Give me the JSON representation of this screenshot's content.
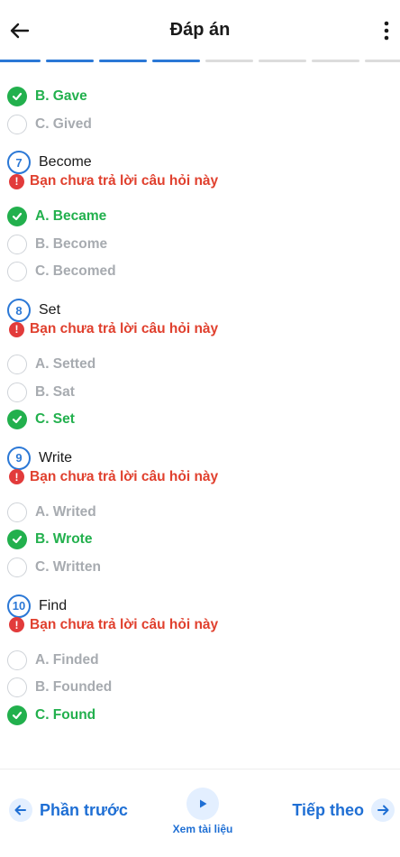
{
  "header": {
    "title": "Đáp án"
  },
  "progress": {
    "total_segments": 8,
    "completed_segments": 4
  },
  "warning_text": "Bạn chưa trả lời câu hỏi này",
  "top_options": [
    {
      "label": "B. Gave",
      "correct": true
    },
    {
      "label": "C. Gived",
      "correct": false
    }
  ],
  "questions": [
    {
      "number": "7",
      "word": "Become",
      "options": [
        {
          "label": "A. Became",
          "correct": true
        },
        {
          "label": "B. Become",
          "correct": false
        },
        {
          "label": "C. Becomed",
          "correct": false
        }
      ]
    },
    {
      "number": "8",
      "word": "Set",
      "options": [
        {
          "label": "A. Setted",
          "correct": false
        },
        {
          "label": "B. Sat",
          "correct": false
        },
        {
          "label": "C. Set",
          "correct": true
        }
      ]
    },
    {
      "number": "9",
      "word": "Write",
      "options": [
        {
          "label": "A. Writed",
          "correct": false
        },
        {
          "label": "B. Wrote",
          "correct": true
        },
        {
          "label": "C. Written",
          "correct": false
        }
      ]
    },
    {
      "number": "10",
      "word": "Find",
      "options": [
        {
          "label": "A. Finded",
          "correct": false
        },
        {
          "label": "B. Founded",
          "correct": false
        },
        {
          "label": "C. Found",
          "correct": true
        }
      ]
    }
  ],
  "footer": {
    "prev_label": "Phần trước",
    "middle_label": "Xem tài liệu",
    "next_label": "Tiếp theo"
  },
  "colors": {
    "accent": "#2b78d6",
    "correct": "#22b04d",
    "warning": "#e0402e",
    "muted": "#a7abb0"
  }
}
